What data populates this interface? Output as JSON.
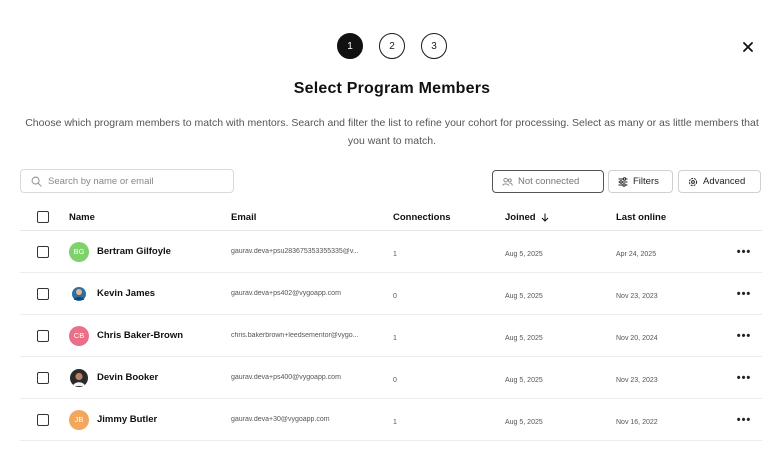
{
  "stepper": {
    "steps": [
      "1",
      "2",
      "3"
    ],
    "active": 0
  },
  "title": "Select Program Members",
  "subtitle": "Choose which program members to match with mentors. Search and filter the list to refine your cohort for processing. Select as many or as little members that you want to match.",
  "search": {
    "placeholder": "Search by name or email",
    "value": ""
  },
  "toolbar": {
    "not_connected": "Not connected",
    "filters": "Filters",
    "advanced": "Advanced"
  },
  "table": {
    "headers": {
      "name": "Name",
      "email": "Email",
      "connections": "Connections",
      "joined": "Joined",
      "last_online": "Last online"
    },
    "rows": [
      {
        "initials": "BG",
        "avatar_color": "#7fd16b",
        "name": "Bertram Gilfoyle",
        "email": "gaurav.deva+psu283675353355335@v...",
        "connections": "1",
        "joined": "Aug 5, 2025",
        "last_online": "Apr 24, 2025"
      },
      {
        "initials": "",
        "avatar_color": "#2c6fa3",
        "name": "Kevin James",
        "email": "gaurav.deva+ps402@vygoapp.com",
        "connections": "0",
        "joined": "Aug 5, 2025",
        "last_online": "Nov 23, 2023"
      },
      {
        "initials": "CB",
        "avatar_color": "#ec6f8a",
        "name": "Chris Baker-Brown",
        "email": "chris.bakerbrown+leedsementor@vygo...",
        "connections": "1",
        "joined": "Aug 5, 2025",
        "last_online": "Nov 20, 2024"
      },
      {
        "initials": "",
        "avatar_color": "#3a3a3a",
        "name": "Devin Booker",
        "email": "gaurav.deva+ps400@vygoapp.com",
        "connections": "0",
        "joined": "Aug 5, 2025",
        "last_online": "Nov 23, 2023"
      },
      {
        "initials": "JB",
        "avatar_color": "#f2a65e",
        "name": "Jimmy Butler",
        "email": "gaurav.deva+30@vygoapp.com",
        "connections": "1",
        "joined": "Aug 5, 2025",
        "last_online": "Nov 16, 2022"
      }
    ]
  },
  "colors": {
    "accent": "#111111",
    "border": "#d9d9d9"
  }
}
